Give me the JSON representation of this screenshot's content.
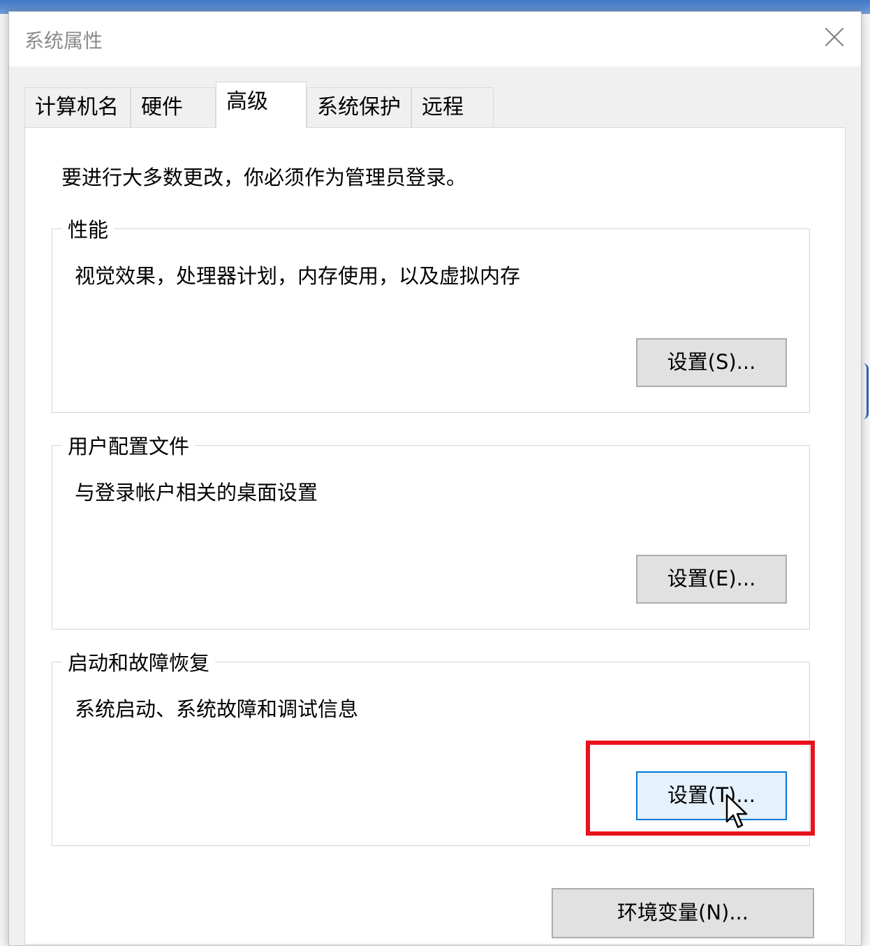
{
  "window": {
    "title": "系统属性",
    "close_label": "×"
  },
  "tabs": [
    {
      "label": "计算机名"
    },
    {
      "label": "硬件"
    },
    {
      "label": "高级",
      "active": true
    },
    {
      "label": "系统保护"
    },
    {
      "label": "远程"
    }
  ],
  "advanced": {
    "admin_note": "要进行大多数更改，你必须作为管理员登录。",
    "performance": {
      "title": "性能",
      "description": "视觉效果，处理器计划，内存使用，以及虚拟内存",
      "button_label": "设置(S)..."
    },
    "user_profiles": {
      "title": "用户配置文件",
      "description": "与登录帐户相关的桌面设置",
      "button_label": "设置(E)..."
    },
    "startup_recovery": {
      "title": "启动和故障恢复",
      "description": "系统启动、系统故障和调试信息",
      "button_label": "设置(T)..."
    },
    "env_button_label": "环境变量(N)..."
  },
  "colors": {
    "highlight": "#e8121d",
    "hover_button_border": "#0078d7",
    "hover_button_bg": "#e5f1fb"
  }
}
